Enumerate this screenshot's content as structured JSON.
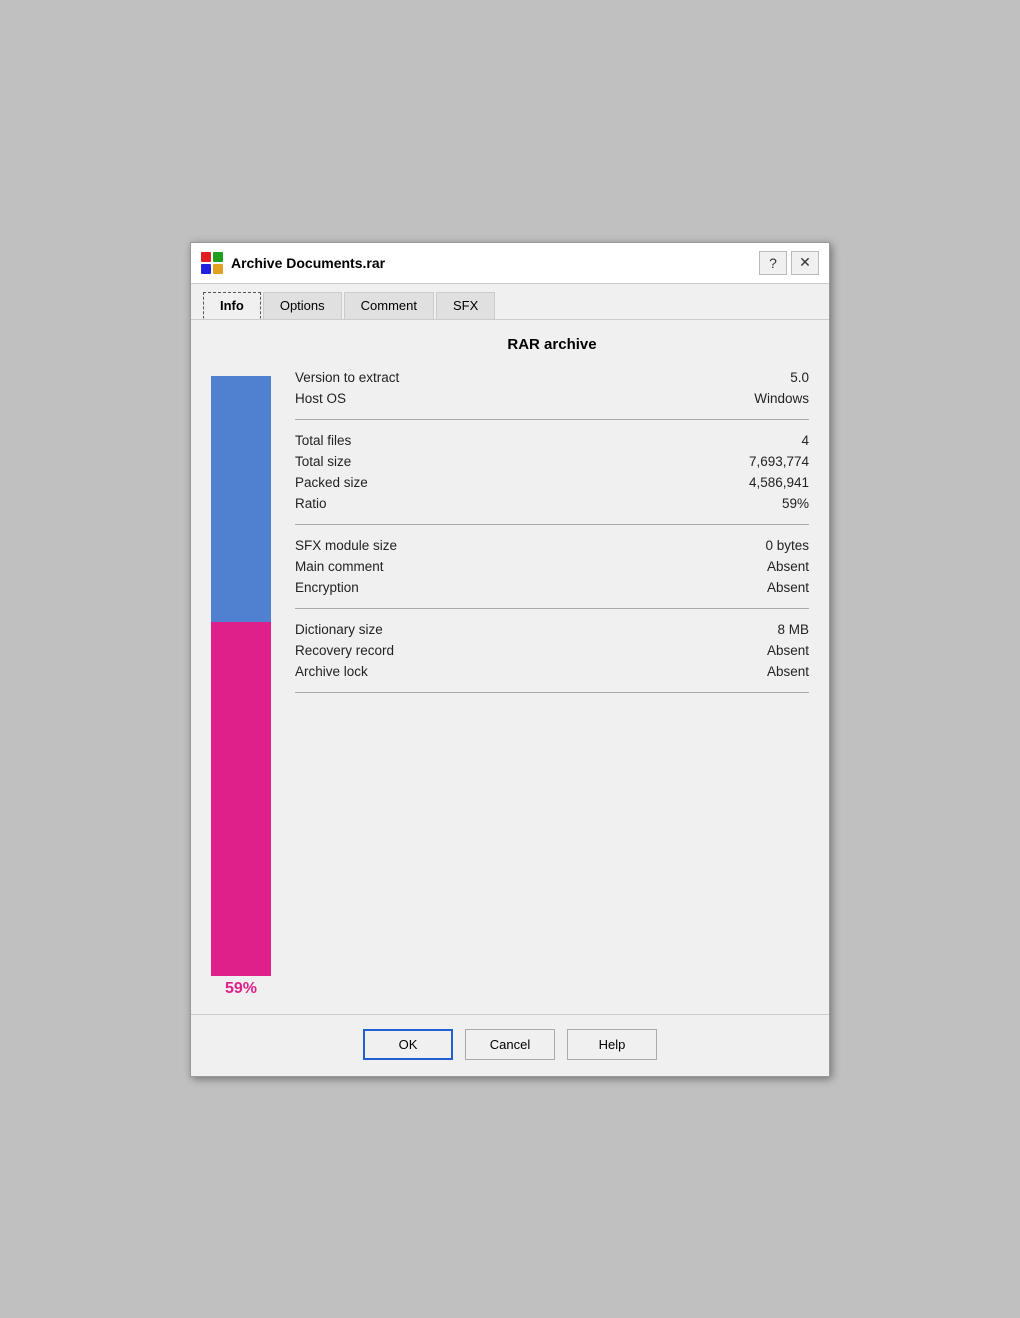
{
  "window": {
    "title": "Archive Documents.rar",
    "help_label": "?",
    "close_label": "✕"
  },
  "tabs": [
    {
      "id": "info",
      "label": "Info",
      "active": true
    },
    {
      "id": "options",
      "label": "Options",
      "active": false
    },
    {
      "id": "comment",
      "label": "Comment",
      "active": false
    },
    {
      "id": "sfx",
      "label": "SFX",
      "active": false
    }
  ],
  "section_title": "RAR archive",
  "chart": {
    "ratio_percent": 59,
    "ratio_label": "59%",
    "bar_packed_height_pct": 41,
    "bar_ratio_height_pct": 59,
    "color_packed": "#5080d0",
    "color_ratio": "#e0208a"
  },
  "info_groups": [
    {
      "rows": [
        {
          "label": "Version to extract",
          "value": "5.0"
        },
        {
          "label": "Host OS",
          "value": "Windows"
        }
      ]
    },
    {
      "rows": [
        {
          "label": "Total files",
          "value": "4"
        },
        {
          "label": "Total size",
          "value": "7,693,774"
        },
        {
          "label": "Packed size",
          "value": "4,586,941"
        },
        {
          "label": "Ratio",
          "value": "59%"
        }
      ]
    },
    {
      "rows": [
        {
          "label": "SFX module size",
          "value": "0 bytes"
        },
        {
          "label": "Main comment",
          "value": "Absent"
        },
        {
          "label": "Encryption",
          "value": "Absent"
        }
      ]
    },
    {
      "rows": [
        {
          "label": "Dictionary size",
          "value": "8 MB"
        },
        {
          "label": "Recovery record",
          "value": "Absent"
        },
        {
          "label": "Archive lock",
          "value": "Absent"
        }
      ]
    }
  ],
  "footer": {
    "ok_label": "OK",
    "cancel_label": "Cancel",
    "help_label": "Help"
  }
}
